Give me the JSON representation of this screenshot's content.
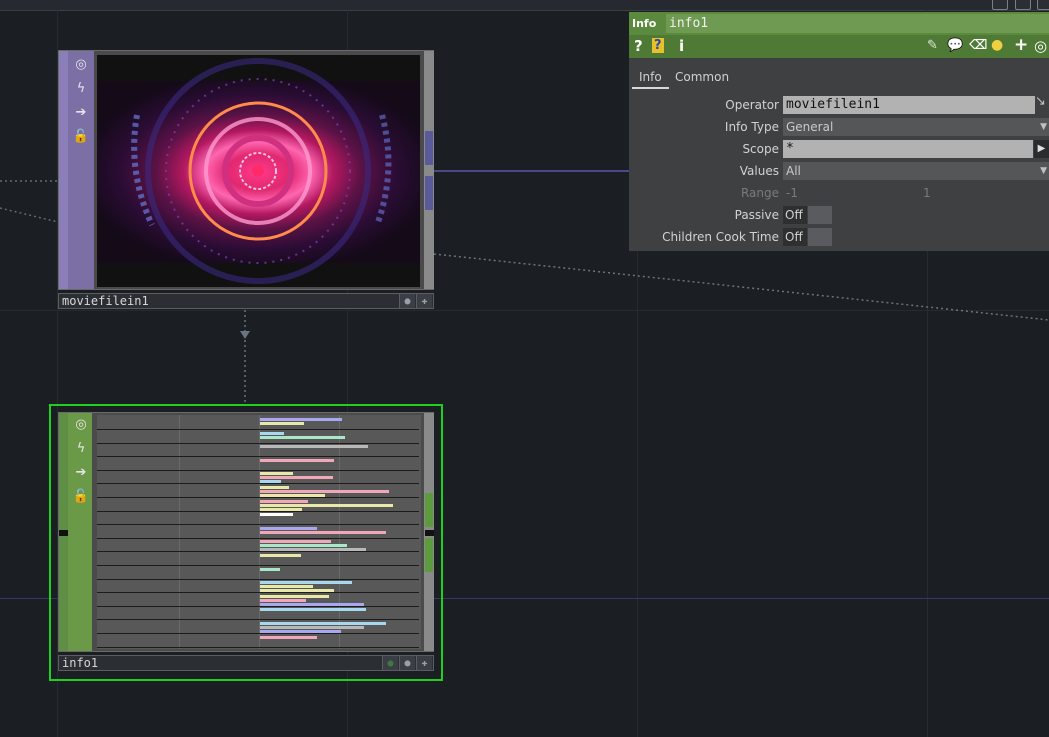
{
  "network": {
    "movie_node": {
      "name": "moviefilein1"
    },
    "info_node": {
      "name": "info1"
    }
  },
  "panel": {
    "op_type": "Info",
    "op_name": "info1",
    "tabs": [
      {
        "label": "Info"
      },
      {
        "label": "Common"
      }
    ],
    "params": {
      "operator": {
        "label": "Operator",
        "value": "moviefilein1"
      },
      "info_type": {
        "label": "Info Type",
        "value": "General"
      },
      "scope": {
        "label": "Scope",
        "value": "*"
      },
      "values": {
        "label": "Values",
        "value": "All"
      },
      "range": {
        "label": "Range",
        "value1": "-1",
        "value2": "1"
      },
      "passive": {
        "label": "Passive",
        "value": "Off"
      },
      "children_cook_time": {
        "label": "Children Cook Time",
        "value": "Off"
      }
    },
    "toolbar": {
      "help_glyph": "?",
      "info_glyph": "i"
    }
  },
  "colors": {
    "background": "#1b1e23",
    "panel_green": "#5b8a3e",
    "selection_green": "#1fd11f",
    "movie_side": "#7b6fa6",
    "info_side": "#5e8f44"
  }
}
